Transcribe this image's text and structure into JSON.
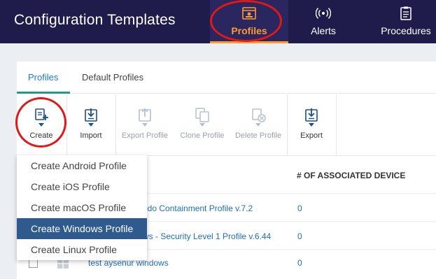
{
  "header": {
    "title": "Configuration Templates",
    "nav": [
      {
        "label": "Profiles",
        "icon": "profiles-icon",
        "active": true
      },
      {
        "label": "Alerts",
        "icon": "alerts-icon"
      },
      {
        "label": "Procedures",
        "icon": "procedures-icon"
      }
    ],
    "accent_color": "#ff9a33",
    "bg_color": "#1f1b4a"
  },
  "tabs": [
    {
      "label": "Profiles",
      "active": true
    },
    {
      "label": "Default Profiles"
    }
  ],
  "toolbar": [
    {
      "label": "Create",
      "icon": "create-icon",
      "enabled": true
    },
    {
      "label": "Import",
      "icon": "import-icon",
      "enabled": true
    },
    {
      "label": "Export Profile",
      "icon": "export-profile-icon",
      "enabled": false
    },
    {
      "label": "Clone Profile",
      "icon": "clone-profile-icon",
      "enabled": false
    },
    {
      "label": "Delete Profile",
      "icon": "delete-profile-icon",
      "enabled": false
    },
    {
      "label": "Export",
      "icon": "export-icon",
      "enabled": true
    }
  ],
  "create_menu": [
    {
      "label": "Create Android Profile"
    },
    {
      "label": "Create iOS Profile"
    },
    {
      "label": "Create macOS Profile"
    },
    {
      "label": "Create Windows Profile",
      "highlighted": true
    },
    {
      "label": "Create Linux Profile"
    }
  ],
  "table": {
    "columns": [
      "# OF ASSOCIATED DEVICE"
    ],
    "rows": [
      {
        "name": "odo Containment Profile v.7.2",
        "devices": "0"
      },
      {
        "name": "ws - Security Level 1 Profile v.6.44",
        "devices": "0"
      },
      {
        "name": "test aysenur windows",
        "devices": "0",
        "os_icon": "windows-icon"
      }
    ]
  }
}
